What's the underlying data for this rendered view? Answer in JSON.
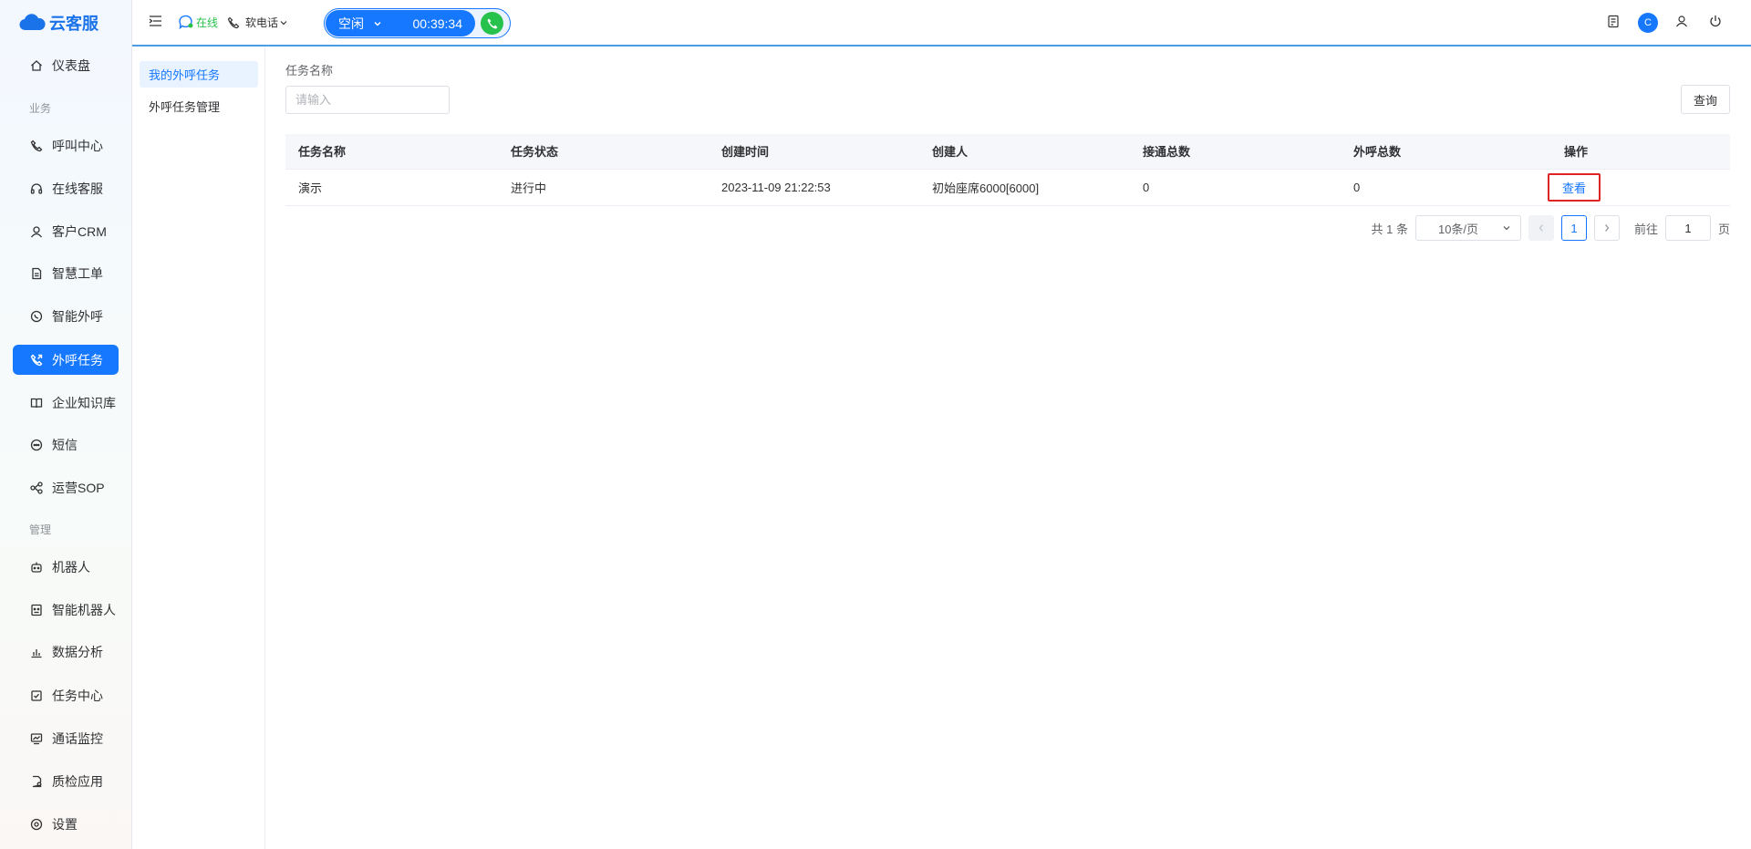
{
  "app": {
    "name": "云客服",
    "brand_color": "#1677ff"
  },
  "sidebar": {
    "items": [
      {
        "label": "仪表盘",
        "icon": "home-icon",
        "active": false
      },
      {
        "label": "呼叫中心",
        "icon": "phone-icon",
        "active": false
      },
      {
        "label": "在线客服",
        "icon": "headset-icon",
        "active": false
      },
      {
        "label": "客户CRM",
        "icon": "user-icon",
        "active": false
      },
      {
        "label": "智慧工单",
        "icon": "document-icon",
        "active": false
      },
      {
        "label": "智能外呼",
        "icon": "whatsapp-icon",
        "active": false
      },
      {
        "label": "外呼任务",
        "icon": "outbound-call-icon",
        "active": true
      },
      {
        "label": "企业知识库",
        "icon": "book-icon",
        "active": false
      },
      {
        "label": "短信",
        "icon": "message-icon",
        "active": false
      },
      {
        "label": "运营SOP",
        "icon": "flow-icon",
        "active": false
      },
      {
        "label": "机器人",
        "icon": "robot-icon",
        "active": false
      },
      {
        "label": "智能机器人",
        "icon": "smart-robot-icon",
        "active": false
      },
      {
        "label": "数据分析",
        "icon": "bar-chart-icon",
        "active": false
      },
      {
        "label": "任务中心",
        "icon": "task-icon",
        "active": false
      },
      {
        "label": "通话监控",
        "icon": "monitor-icon",
        "active": false
      },
      {
        "label": "质检应用",
        "icon": "inspect-icon",
        "active": false
      },
      {
        "label": "设置",
        "icon": "gear-icon",
        "active": false
      }
    ],
    "sections": {
      "business": "业务",
      "management": "管理"
    }
  },
  "topbar": {
    "online_status": "在线",
    "phone_mode": "软电话",
    "agent_state": "空闲",
    "timer": "00:39:34",
    "avatar_letter": "C"
  },
  "subnav": {
    "items": [
      {
        "label": "我的外呼任务",
        "active": true
      },
      {
        "label": "外呼任务管理",
        "active": false
      }
    ]
  },
  "filter": {
    "label": "任务名称",
    "placeholder": "请输入",
    "query_button": "查询"
  },
  "table": {
    "columns": [
      "任务名称",
      "任务状态",
      "创建时间",
      "创建人",
      "接通总数",
      "外呼总数",
      "操作"
    ],
    "rows": [
      {
        "name": "演示",
        "status": "进行中",
        "created": "2023-11-09 21:22:53",
        "creator": "初始座席6000[6000]",
        "connected": "0",
        "total": "0",
        "action": "查看"
      }
    ]
  },
  "pagination": {
    "total_text": "共 1 条",
    "page_size": "10条/页",
    "current_page": "1",
    "goto_label": "前往",
    "goto_value": "1",
    "page_suffix": "页"
  }
}
